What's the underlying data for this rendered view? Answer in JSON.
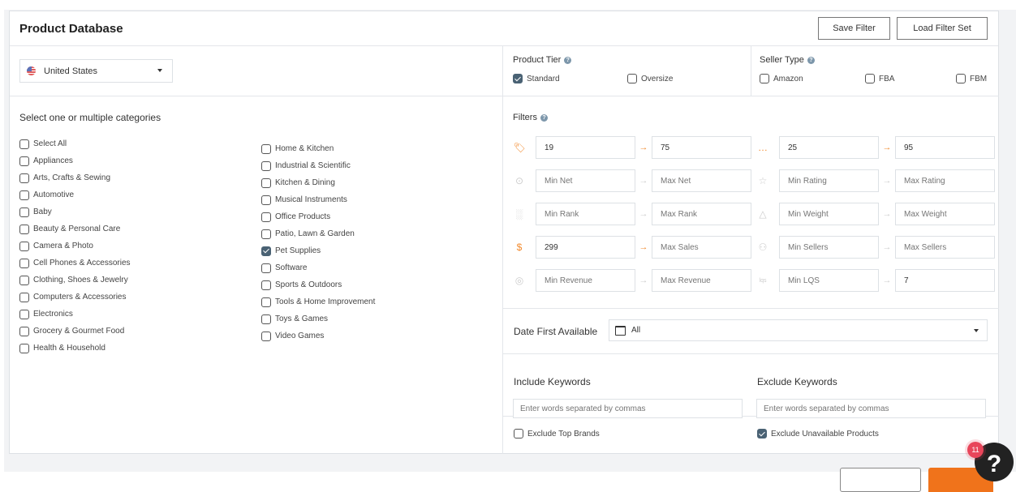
{
  "header": {
    "title": "Product Database",
    "save_filter_label": "Save Filter",
    "load_filter_set_label": "Load Filter Set"
  },
  "country": {
    "selected": "United States",
    "flag_icon": "us-flag-icon"
  },
  "categories": {
    "title": "Select one or multiple categories",
    "column1": [
      {
        "label": "Select All",
        "checked": false
      },
      {
        "label": "Appliances",
        "checked": false
      },
      {
        "label": "Arts, Crafts & Sewing",
        "checked": false
      },
      {
        "label": "Automotive",
        "checked": false
      },
      {
        "label": "Baby",
        "checked": false
      },
      {
        "label": "Beauty & Personal Care",
        "checked": false
      },
      {
        "label": "Camera & Photo",
        "checked": false
      },
      {
        "label": "Cell Phones & Accessories",
        "checked": false
      },
      {
        "label": "Clothing, Shoes & Jewelry",
        "checked": false
      },
      {
        "label": "Computers & Accessories",
        "checked": false
      },
      {
        "label": "Electronics",
        "checked": false
      },
      {
        "label": "Grocery & Gourmet Food",
        "checked": false
      },
      {
        "label": "Health & Household",
        "checked": false
      }
    ],
    "column2": [
      {
        "label": "Home & Kitchen",
        "checked": false
      },
      {
        "label": "Industrial & Scientific",
        "checked": false
      },
      {
        "label": "Kitchen & Dining",
        "checked": false
      },
      {
        "label": "Musical Instruments",
        "checked": false
      },
      {
        "label": "Office Products",
        "checked": false
      },
      {
        "label": "Patio, Lawn & Garden",
        "checked": false
      },
      {
        "label": "Pet Supplies",
        "checked": true
      },
      {
        "label": "Software",
        "checked": false
      },
      {
        "label": "Sports & Outdoors",
        "checked": false
      },
      {
        "label": "Tools & Home Improvement",
        "checked": false
      },
      {
        "label": "Toys & Games",
        "checked": false
      },
      {
        "label": "Video Games",
        "checked": false
      }
    ]
  },
  "product_tier": {
    "label": "Product Tier",
    "options": [
      {
        "label": "Standard",
        "checked": true
      },
      {
        "label": "Oversize",
        "checked": false
      }
    ]
  },
  "seller_type": {
    "label": "Seller Type",
    "options": [
      {
        "label": "Amazon",
        "checked": false
      },
      {
        "label": "FBA",
        "checked": false
      },
      {
        "label": "FBM",
        "checked": false
      }
    ]
  },
  "filters": {
    "label": "Filters",
    "left": [
      {
        "icon": "price-tag-icon",
        "min_value": "19",
        "min_placeholder": "",
        "max_value": "75",
        "max_placeholder": "",
        "active": true
      },
      {
        "icon": "money-bag-icon",
        "min_value": "",
        "min_placeholder": "Min Net",
        "max_value": "",
        "max_placeholder": "Max Net",
        "active": false
      },
      {
        "icon": "rank-chart-icon",
        "min_value": "",
        "min_placeholder": "Min Rank",
        "max_value": "",
        "max_placeholder": "Max Rank",
        "active": false
      },
      {
        "icon": "sales-dollar-icon",
        "min_value": "299",
        "min_placeholder": "",
        "max_value": "",
        "max_placeholder": "Max Sales",
        "active": true
      },
      {
        "icon": "revenue-icon",
        "min_value": "",
        "min_placeholder": "Min Revenue",
        "max_value": "",
        "max_placeholder": "Max Revenue",
        "active": false
      }
    ],
    "right": [
      {
        "icon": "reviews-chat-icon",
        "min_value": "25",
        "min_placeholder": "",
        "max_value": "95",
        "max_placeholder": "",
        "active": true
      },
      {
        "icon": "star-icon",
        "min_value": "",
        "min_placeholder": "Min Rating",
        "max_value": "",
        "max_placeholder": "Max Rating",
        "active": false
      },
      {
        "icon": "weight-bag-icon",
        "min_value": "",
        "min_placeholder": "Min Weight",
        "max_value": "",
        "max_placeholder": "Max Weight",
        "active": false
      },
      {
        "icon": "sellers-icon",
        "min_value": "",
        "min_placeholder": "Min Sellers",
        "max_value": "",
        "max_placeholder": "Max Sellers",
        "active": false
      },
      {
        "icon": "lqs-icon",
        "min_value": "",
        "min_placeholder": "Min LQS",
        "max_value": "7",
        "max_placeholder": "",
        "active": false
      }
    ]
  },
  "date_first_available": {
    "label": "Date First Available",
    "selected": "All"
  },
  "keywords": {
    "include_label": "Include Keywords",
    "include_placeholder": "Enter words separated by commas",
    "exclude_label": "Exclude Keywords",
    "exclude_placeholder": "Enter words separated by commas"
  },
  "exclusions": {
    "top_brands_label": "Exclude Top Brands",
    "top_brands_checked": false,
    "unavailable_label": "Exclude Unavailable Products",
    "unavailable_checked": true
  },
  "help": {
    "badge_count": "11",
    "glyph": "?"
  },
  "colors": {
    "accent": "#f28a2e",
    "checkbox_checked": "#4a6274",
    "badge": "#e8455a"
  }
}
